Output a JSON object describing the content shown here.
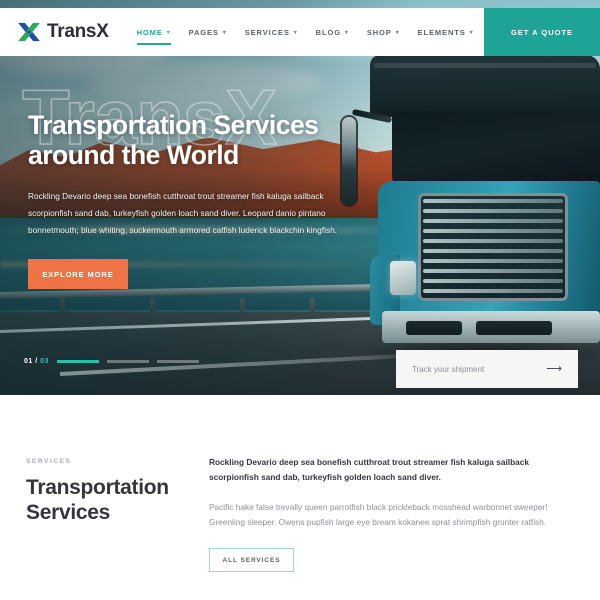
{
  "brand": {
    "name": "TransX",
    "logo_icon": "x-mark-logo",
    "color_primary": "#1ea396",
    "color_accent": "#ef7344",
    "logo_blue": "#1b52a8",
    "logo_green": "#2fa85c"
  },
  "header": {
    "nav": [
      {
        "label": "HOME",
        "active": true,
        "caret": "▾"
      },
      {
        "label": "PAGES",
        "active": false,
        "caret": "▾"
      },
      {
        "label": "SERVICES",
        "active": false,
        "caret": "▾"
      },
      {
        "label": "BLOG",
        "active": false,
        "caret": "▾"
      },
      {
        "label": "SHOP",
        "active": false,
        "caret": "▾"
      },
      {
        "label": "ELEMENTS",
        "active": false,
        "caret": "▾"
      }
    ],
    "quote_button": "GET A QUOTE"
  },
  "hero": {
    "watermark": "TransX",
    "title_line1": "Transportation Services",
    "title_line2": "around the World",
    "description": "Rockling Devario deep sea bonefish cutthroat trout streamer fish kaluga sailback scorpionfish sand dab, turkeyfish golden loach sand diver. Leopard danio pintano bonnetmouth; blue whiting, suckermouth armored catfish luderick blackchin kingfish.",
    "cta": "EXPLORE MORE",
    "slider": {
      "current": "01",
      "separator": "/",
      "total": "03",
      "slides": 3,
      "active_index": 0
    },
    "track": {
      "label": "Track your shipment",
      "arrow_icon": "arrow-right-icon"
    }
  },
  "services": {
    "eyebrow": "SERVICES",
    "title_line1": "Transportation",
    "title_line2": "Services",
    "lead": "Rockling Devario deep sea bonefish cutthroat trout streamer fish kaluga sailback scorpionfish sand dab, turkeyfish golden loach sand diver.",
    "body": "Pacific hake false trevally queen parrotfish black prickleback mosshead warbonnet sweeper! Greenling sleeper. Owens pupfish large eye bream kokanee sprat shrimpfish grunter ratfish.",
    "button": "ALL SERVICES"
  }
}
